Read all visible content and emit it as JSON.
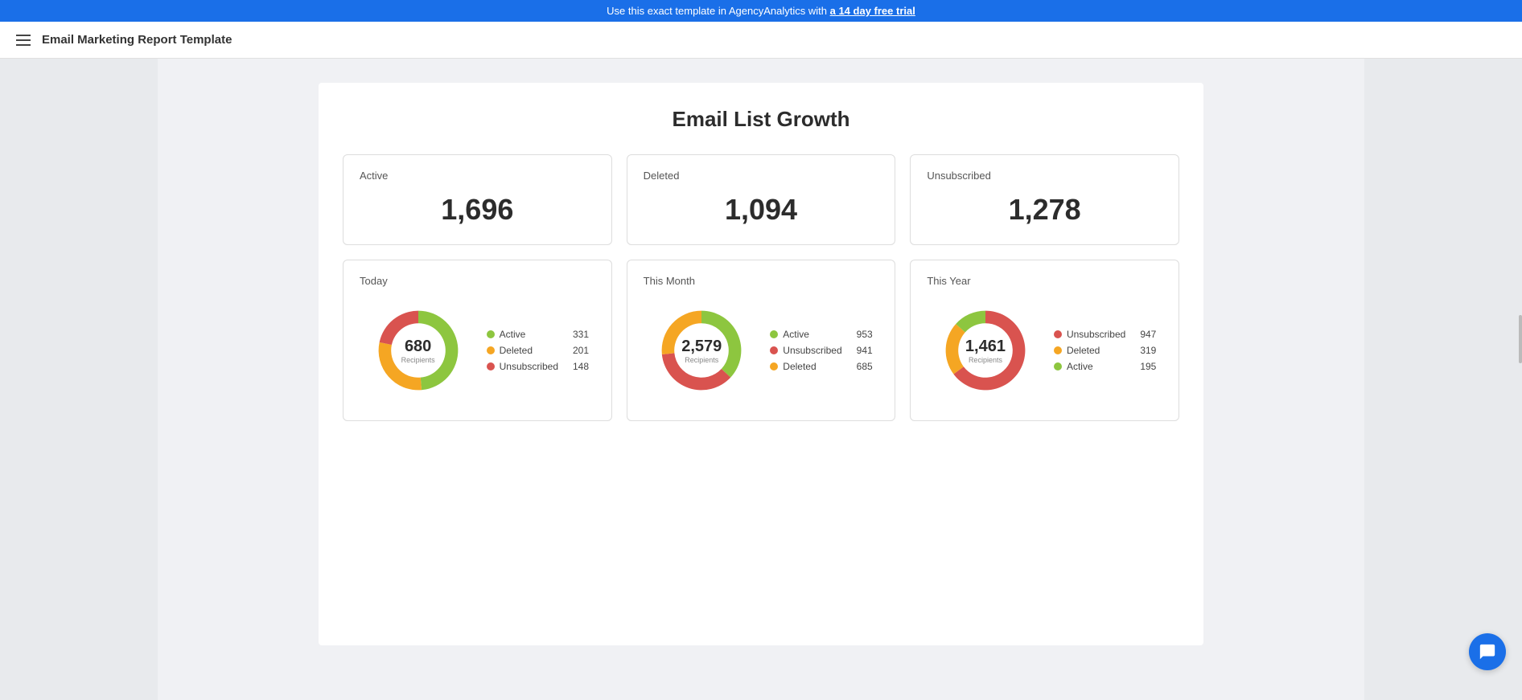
{
  "banner": {
    "text_before": "Use this exact template in AgencyAnalytics with ",
    "link_text": "a 14 day free trial",
    "text_after": ""
  },
  "header": {
    "title": "Email Marketing Report Template"
  },
  "page": {
    "title": "Email List Growth"
  },
  "stat_cards": [
    {
      "label": "Active",
      "value": "1,696"
    },
    {
      "label": "Deleted",
      "value": "1,094"
    },
    {
      "label": "Unsubscribed",
      "value": "1,278"
    }
  ],
  "donut_cards": [
    {
      "label": "Today",
      "center_num": "680",
      "center_sub": "Recipients",
      "segments": [
        {
          "color": "#8dc63f",
          "pct": 48.7,
          "label": "Active",
          "value": "331"
        },
        {
          "color": "#f5a623",
          "pct": 29.6,
          "label": "Deleted",
          "value": "201"
        },
        {
          "color": "#d9534f",
          "pct": 21.7,
          "label": "Unsubscribed",
          "value": "148"
        }
      ]
    },
    {
      "label": "This Month",
      "center_num": "2,579",
      "center_sub": "Recipients",
      "segments": [
        {
          "color": "#8dc63f",
          "pct": 36.9,
          "label": "Active",
          "value": "953"
        },
        {
          "color": "#d9534f",
          "pct": 36.5,
          "label": "Unsubscribed",
          "value": "941"
        },
        {
          "color": "#f5a623",
          "pct": 26.6,
          "label": "Deleted",
          "value": "685"
        }
      ]
    },
    {
      "label": "This Year",
      "center_num": "1,461",
      "center_sub": "Recipients",
      "segments": [
        {
          "color": "#d9534f",
          "pct": 64.8,
          "label": "Unsubscribed",
          "value": "947"
        },
        {
          "color": "#f5a623",
          "pct": 21.8,
          "label": "Deleted",
          "value": "319"
        },
        {
          "color": "#8dc63f",
          "pct": 13.4,
          "label": "Active",
          "value": "195"
        }
      ]
    }
  ]
}
